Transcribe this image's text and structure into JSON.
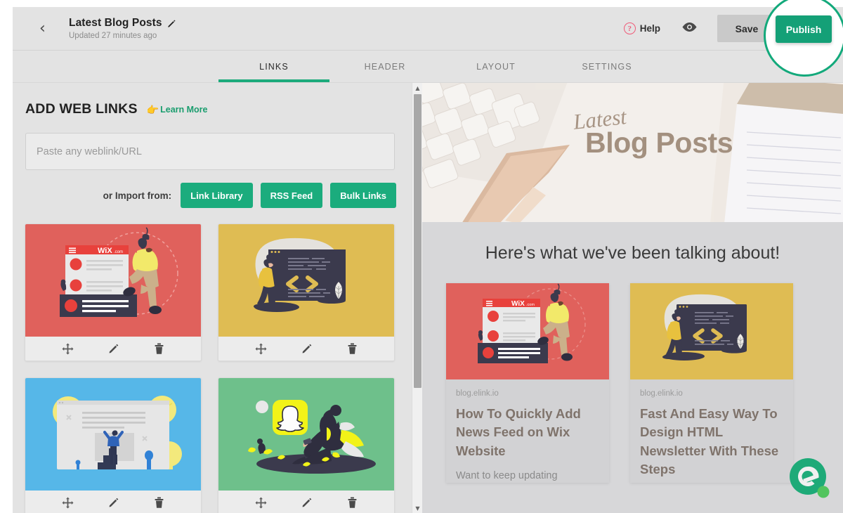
{
  "topbar": {
    "back_icon": "chevron-left-icon",
    "doc_title": "Latest Blog Posts",
    "edit_icon": "pencil-icon",
    "updated_text": "Updated 27 minutes ago",
    "help_label": "Help",
    "help_icon": "question-circle-icon",
    "preview_icon": "eye-icon",
    "save_label": "Save",
    "publish_label": "Publish",
    "accent_green": "#14a077",
    "help_color": "#ef5a78",
    "save_bg": "#c9c9c9"
  },
  "tabs": [
    {
      "label": "LINKS",
      "active": true
    },
    {
      "label": "HEADER",
      "active": false
    },
    {
      "label": "LAYOUT",
      "active": false
    },
    {
      "label": "SETTINGS",
      "active": false
    }
  ],
  "left_panel": {
    "title": "ADD WEB LINKS",
    "learn_more": "Learn More",
    "learn_more_icon": "pointing-hand-icon",
    "url_placeholder": "Paste any weblink/URL",
    "url_value": "",
    "import_label": "or Import from:",
    "import_buttons": [
      "Link Library",
      "RSS Feed",
      "Bulk Links"
    ],
    "card_action_icons": [
      "move-icon",
      "pencil-icon",
      "trash-icon"
    ],
    "cards": [
      {
        "name": "wix-news-feed-card",
        "bg": "#e0615c",
        "art": "wix"
      },
      {
        "name": "html-code-card",
        "bg": "#dfbc53",
        "art": "code"
      },
      {
        "name": "website-ideas-card",
        "bg": "#56b7e8",
        "art": "ideas"
      },
      {
        "name": "snapchat-card",
        "bg": "#6ec08b",
        "art": "snapchat"
      }
    ]
  },
  "scrollbar": {
    "up_arrow": "chevron-up-icon",
    "down_arrow": "chevron-down-icon"
  },
  "preview": {
    "hero_script": "Latest",
    "hero_title": "Blog Posts",
    "heading": "Here's what we've been talking about!",
    "brand_logo": "elink-logo",
    "cards": [
      {
        "source": "blog.elink.io",
        "title": "How To Quickly Add News Feed on Wix Website",
        "description": "Want to keep updating",
        "bg": "#e0615c",
        "art": "wix"
      },
      {
        "source": "blog.elink.io",
        "title": "Fast And Easy Way To Design HTML Newsletter With These Steps",
        "description": "",
        "bg": "#dfbc53",
        "art": "code"
      }
    ]
  }
}
